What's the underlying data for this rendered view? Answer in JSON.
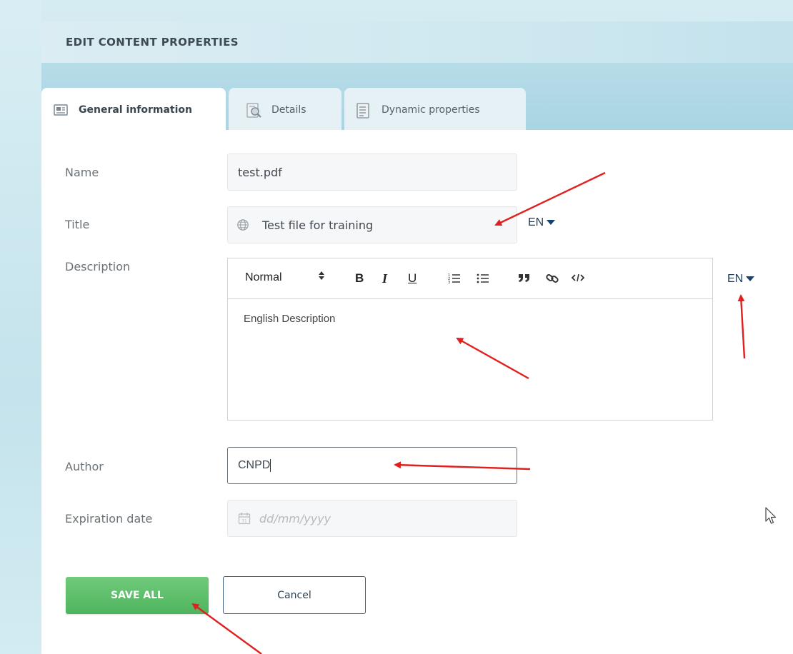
{
  "header": {
    "title": "EDIT CONTENT PROPERTIES"
  },
  "tabs": [
    {
      "label": "General information",
      "icon": "document-icon",
      "active": true
    },
    {
      "label": "Details",
      "icon": "magnify-document-icon",
      "active": false
    },
    {
      "label": "Dynamic properties",
      "icon": "list-document-icon",
      "active": false
    }
  ],
  "form": {
    "name": {
      "label": "Name",
      "value": "test.pdf"
    },
    "title": {
      "label": "Title",
      "value": "Test file for training",
      "lang": "EN",
      "icon": "globe-icon"
    },
    "description": {
      "label": "Description",
      "lang": "EN",
      "toolbar": {
        "format": "Normal",
        "bold": "B",
        "italic": "I",
        "underline": "U"
      },
      "content": "English Description"
    },
    "author": {
      "label": "Author",
      "value": "CNPD"
    },
    "expiration": {
      "label": "Expiration date",
      "placeholder": "dd/mm/yyyy",
      "icon": "calendar-icon"
    }
  },
  "actions": {
    "save_label": "SAVE ALL",
    "cancel_label": "Cancel"
  },
  "colors": {
    "accent_green": "#5cbd69",
    "annotation_red": "#e02020",
    "link_blue": "#16436c"
  }
}
